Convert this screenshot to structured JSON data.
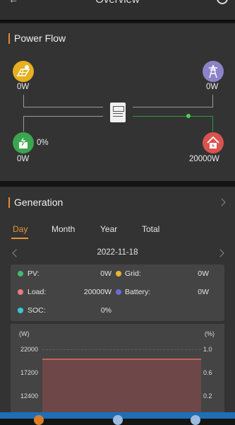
{
  "header": {
    "title": "Overview"
  },
  "power_flow": {
    "title": "Power Flow",
    "pv": {
      "value": "0W",
      "icon": "solar-panel-icon",
      "color": "#e6b020"
    },
    "grid": {
      "value": "0W",
      "icon": "transmission-tower-icon",
      "color": "#8c82c8"
    },
    "battery": {
      "value": "0W",
      "percent": "0%",
      "icon": "battery-charging-icon",
      "color": "#3aa64e"
    },
    "load": {
      "value": "20000W",
      "icon": "home-icon",
      "color": "#d9534f"
    }
  },
  "generation": {
    "title": "Generation",
    "tabs": [
      "Day",
      "Month",
      "Year",
      "Total"
    ],
    "active_tab": "Day",
    "date": "2022-11-18",
    "stats": {
      "pv": {
        "label": "PV:",
        "value": "0W",
        "color": "#3ebd6e"
      },
      "grid": {
        "label": "Grid:",
        "value": "0W",
        "color": "#e8b530"
      },
      "load": {
        "label": "Load:",
        "value": "20000W",
        "color": "#e87d7d"
      },
      "battery": {
        "label": "Battery:",
        "value": "0W",
        "color": "#6b6be0"
      },
      "soc": {
        "label": "SOC:",
        "value": "0%",
        "color": "#3ec5d6"
      }
    },
    "chart": {
      "left_unit": "(W)",
      "right_unit": "(%)",
      "left_ticks": [
        "22000",
        "17200",
        "12400"
      ],
      "right_ticks": [
        "1.0",
        "0.6",
        "0.2"
      ]
    }
  },
  "chart_data": {
    "type": "area",
    "series": [
      {
        "name": "Load",
        "values": [
          20000,
          20000
        ]
      }
    ],
    "y_ticks_left": [
      22000,
      17200,
      12400
    ],
    "y_ticks_right": [
      1.0,
      0.6,
      0.2
    ]
  }
}
